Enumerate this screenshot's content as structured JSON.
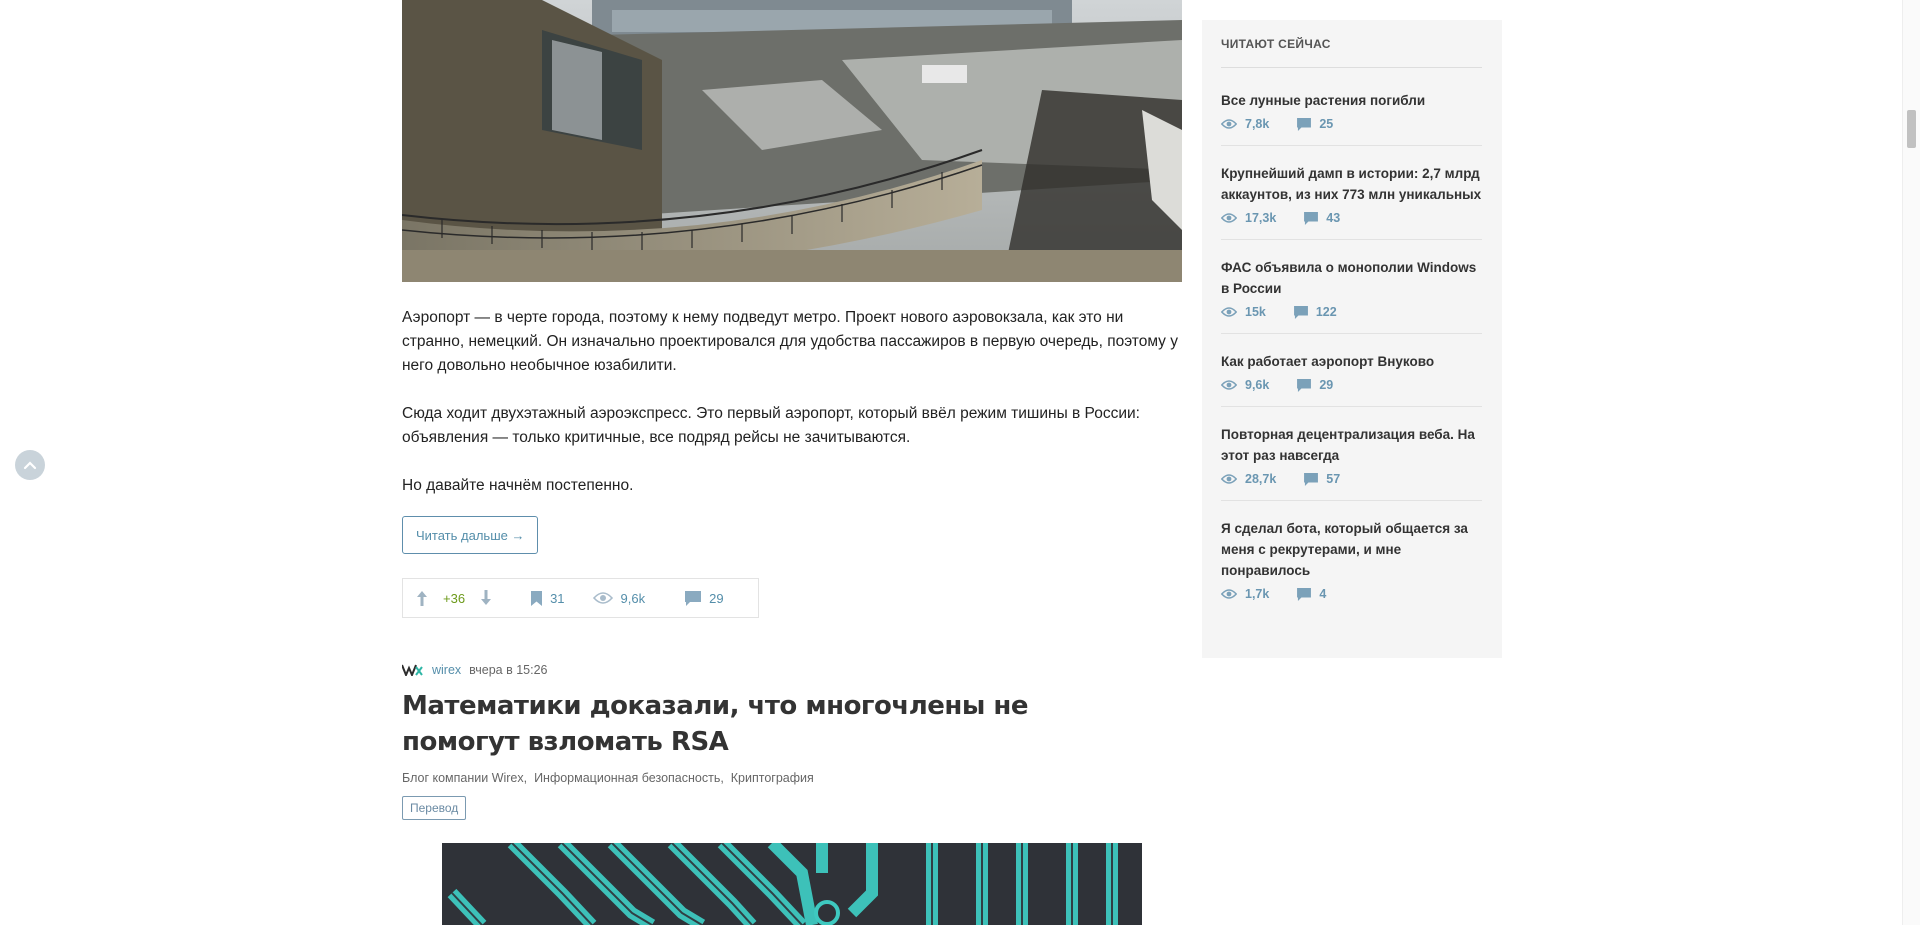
{
  "article": {
    "paragraphs": [
      "Аэропорт — в черте города, поэтому к нему подведут метро. Проект нового аэровокзала, как это ни странно, немецкий. Он изначально проектировался для удобства пассажиров в первую очередь, поэтому у него довольно необычное юзабилити.",
      "Сюда ходит двухэтажный аэроэкспресс. Это первый аэропорт, который ввёл режим тишины в России: объявления — только критичные, все подряд рейсы не зачитываются.",
      "Но давайте начнём постепенно."
    ],
    "read_more": "Читать дальше →",
    "stats": {
      "votes": "+36",
      "bookmarks": "31",
      "views": "9,6k",
      "comments": "29"
    }
  },
  "next_post": {
    "author": "wirex",
    "time": "вчера в 15:26",
    "title": "Математики доказали, что многочлены не помогут взломать RSA",
    "hubs": [
      "Блог компании Wirex",
      "Информационная безопасность",
      "Криптография"
    ],
    "tag": "Перевод"
  },
  "sidebar": {
    "heading": "ЧИТАЮТ СЕЙЧАС",
    "items": [
      {
        "title": "Все лунные растения погибли",
        "views": "7,8k",
        "comments": "25"
      },
      {
        "title": "Крупнейший дамп в истории: 2,7 млрд аккаунтов, из них 773 млн уникальных",
        "views": "17,3k",
        "comments": "43"
      },
      {
        "title": "ФАС объявила о монополии Windows в России",
        "views": "15k",
        "comments": "122"
      },
      {
        "title": "Как работает аэропорт Внуково",
        "views": "9,6k",
        "comments": "29"
      },
      {
        "title": "Повторная децентрализация веба. На этот раз навсегда",
        "views": "28,7k",
        "comments": "57"
      },
      {
        "title": "Я сделал бота, который общается за меня с рекрутерами, и мне понравилось",
        "views": "1,7k",
        "comments": "4"
      }
    ]
  },
  "colors": {
    "accent": "#548eaa",
    "vote_positive": "#6c9a1a",
    "sidebar_bg": "#f5f5f5"
  }
}
